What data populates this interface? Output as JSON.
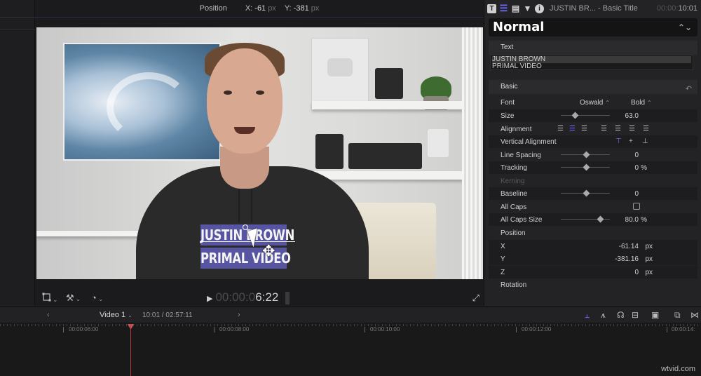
{
  "viewer": {
    "overlay_label": "Position",
    "x_label": "X:",
    "x_value": "-61",
    "y_label": "Y:",
    "y_value": "-381",
    "unit": "px"
  },
  "video_title": {
    "line1": "JUSTIN BROWN",
    "line2": "PRIMAL VIDEO"
  },
  "transport": {
    "timecode_dim": "00:00:0",
    "timecode": "6:22"
  },
  "inspector": {
    "header_name": "JUSTIN BR... - Basic Title",
    "header_time": "10:01",
    "style": "Normal",
    "text_section": "Text",
    "text_line1": "JUSTIN BROWN",
    "text_line2": "PRIMAL VIDEO",
    "basic_section": "Basic",
    "rows": {
      "font_label": "Font",
      "font_value": "Oswald",
      "font_weight": "Bold",
      "size_label": "Size",
      "size_value": "63.0",
      "alignment_label": "Alignment",
      "valign_label": "Vertical Alignment",
      "line_spacing_label": "Line Spacing",
      "line_spacing_value": "0",
      "tracking_label": "Tracking",
      "tracking_value": "0",
      "tracking_unit": "%",
      "kerning_label": "Kerning",
      "baseline_label": "Baseline",
      "baseline_value": "0",
      "all_caps_label": "All Caps",
      "all_caps_size_label": "All Caps Size",
      "all_caps_size_value": "80.0",
      "all_caps_size_unit": "%",
      "position_label": "Position",
      "x_label": "X",
      "x_value": "-61.14",
      "y_label": "Y",
      "y_value": "-381.16",
      "z_label": "Z",
      "z_value": "0",
      "unit": "px",
      "rotation_label": "Rotation"
    },
    "slider_levels": {
      "size": 0.25,
      "line_spacing": 0.5,
      "tracking": 0.5,
      "baseline": 0.5,
      "all_caps_size": 0.8
    }
  },
  "timeline": {
    "project_name": "Video 1",
    "project_tc": "10:01 / 02:57:11",
    "ruler_labels": [
      "00:00:06:00",
      "00:00:08:00",
      "00:00:10:00",
      "00:00:12:00",
      "00:00:14:"
    ]
  },
  "watermark": "wtvid.com",
  "colors": {
    "accent": "#6f6bff",
    "title_bg": "#5a57a8",
    "panel_bg": "#232325",
    "playhead": "#c55555"
  }
}
